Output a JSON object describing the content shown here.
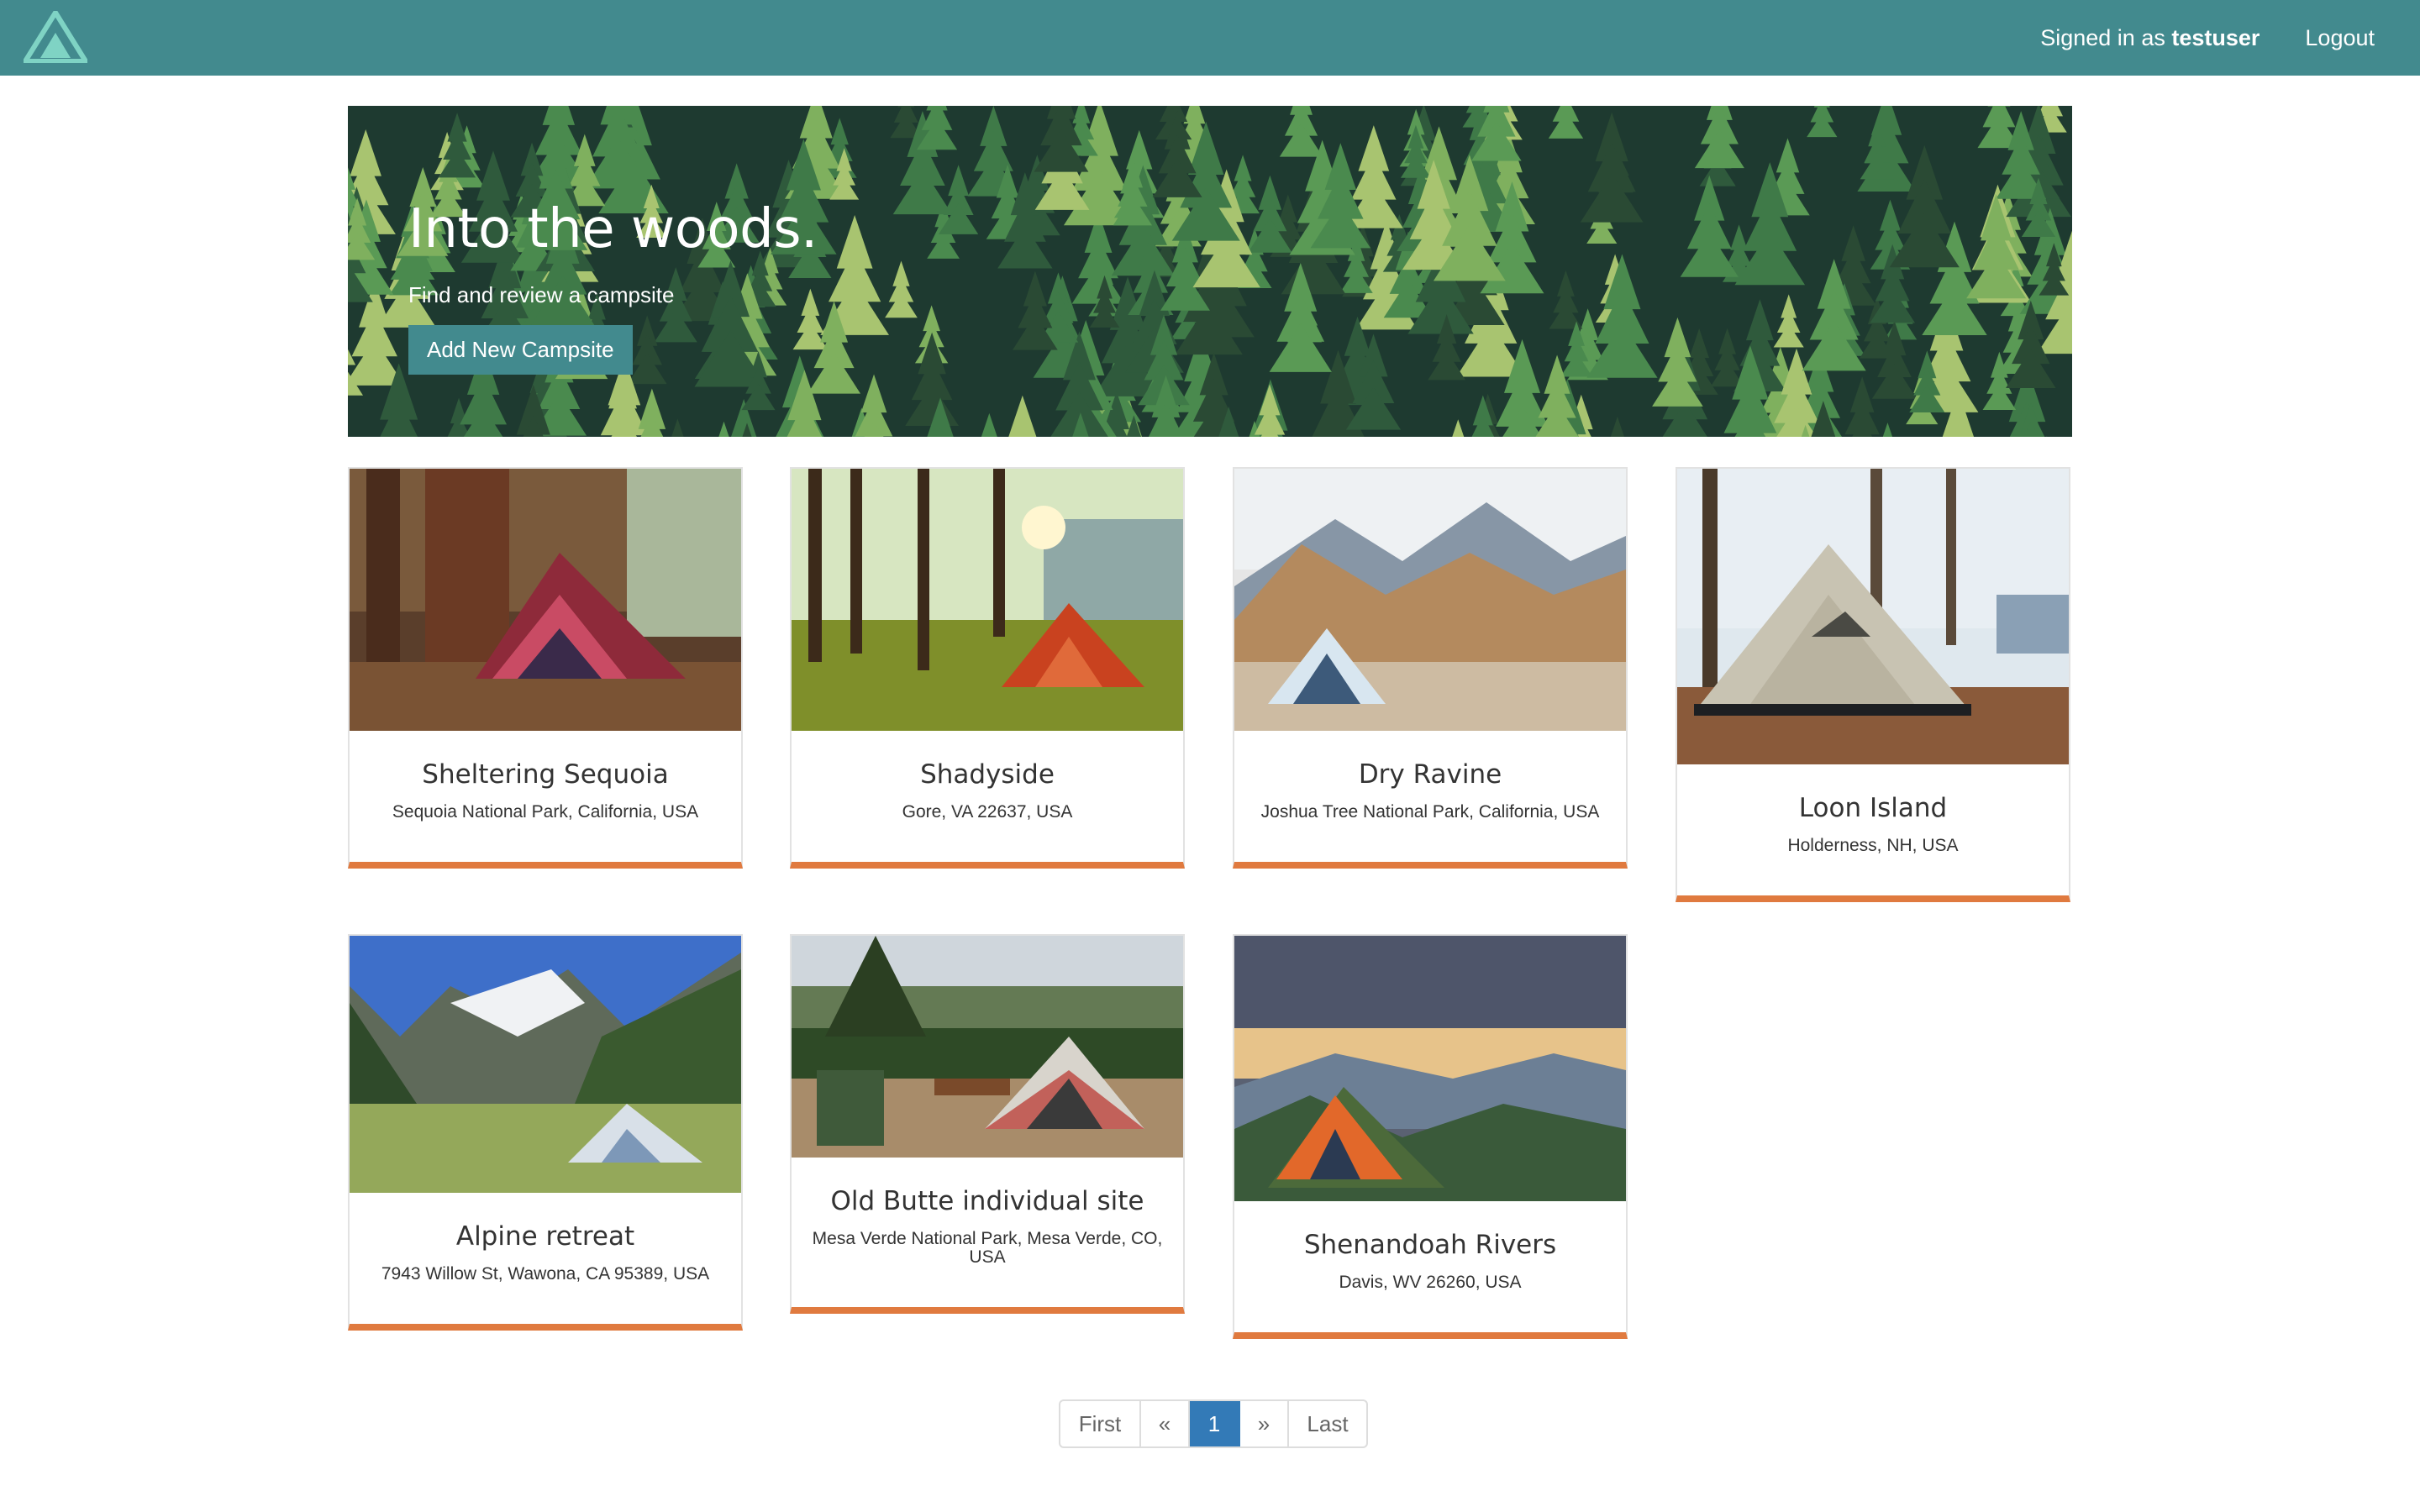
{
  "nav": {
    "signed_in_prefix": "Signed in as",
    "username": "testuser",
    "logout_label": "Logout"
  },
  "hero": {
    "title": "Into the woods.",
    "subtitle": "Find and review a campsite",
    "button_label": "Add New Campsite"
  },
  "campsites": [
    {
      "name": "Sheltering Sequoia",
      "location": "Sequoia National Park, California, USA"
    },
    {
      "name": "Shadyside",
      "location": "Gore, VA 22637, USA"
    },
    {
      "name": "Dry Ravine",
      "location": "Joshua Tree National Park, California, USA"
    },
    {
      "name": "Loon Island",
      "location": "Holderness, NH, USA"
    },
    {
      "name": "Alpine retreat",
      "location": "7943 Willow St, Wawona, CA 95389, USA"
    },
    {
      "name": "Old Butte individual site",
      "location": "Mesa Verde National Park, Mesa Verde, CO, USA"
    },
    {
      "name": "Shenandoah Rivers",
      "location": "Davis, WV 26260, USA"
    }
  ],
  "pagination": {
    "first": "First",
    "prev": "«",
    "current": "1",
    "next": "»",
    "last": "Last"
  },
  "colors": {
    "navbar": "#428a8e",
    "accent_border": "#e07a3f",
    "active_page": "#337ab7"
  }
}
